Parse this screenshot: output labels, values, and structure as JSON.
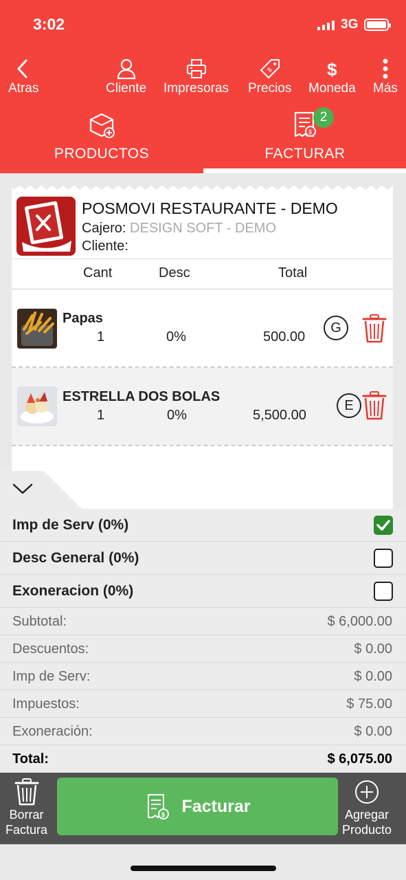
{
  "status_bar": {
    "time": "3:02",
    "network": "3G"
  },
  "toolbar": {
    "back_label": "Atras",
    "cliente_label": "Cliente",
    "impresoras_label": "Impresoras",
    "precios_label": "Precios",
    "moneda_symbol": "$",
    "moneda_label": "Moneda",
    "mas_label": "Más"
  },
  "tabs": {
    "productos_label": "PRODUCTOS",
    "facturar_label": "FACTURAR",
    "facturar_badge": "2",
    "active": "FACTURAR"
  },
  "receipt": {
    "restaurant_name": "POSMOVI RESTAURANTE - DEMO",
    "cajero_label": "Cajero:",
    "cajero_value": "DESIGN SOFT - DEMO",
    "cliente_label": "Cliente:",
    "columns": {
      "cant": "Cant",
      "desc": "Desc",
      "total": "Total"
    },
    "items": [
      {
        "name": "Papas",
        "qty": "1",
        "desc": "0%",
        "total": "500.00",
        "tag": "G"
      },
      {
        "name": "ESTRELLA DOS BOLAS",
        "qty": "1",
        "desc": "0%",
        "total": "5,500.00",
        "tag": "E"
      }
    ]
  },
  "options": [
    {
      "label": "Imp de Serv (0%)",
      "checked": true
    },
    {
      "label": "Desc General (0%)",
      "checked": false
    },
    {
      "label": "Exoneracion (0%)",
      "checked": false
    }
  ],
  "summary": {
    "subtotal_label": "Subtotal:",
    "subtotal_value": "$ 6,000.00",
    "descuentos_label": "Descuentos:",
    "descuentos_value": "$ 0.00",
    "impserv_label": "Imp de Serv:",
    "impserv_value": "$ 0.00",
    "impuestos_label": "Impuestos:",
    "impuestos_value": "$ 75.00",
    "exoneracion_label": "Exoneración:",
    "exoneracion_value": "$ 0.00",
    "total_label": "Total:",
    "total_value": "$ 6,075.00"
  },
  "bottom_bar": {
    "borrar_line1": "Borrar",
    "borrar_line2": "Factura",
    "facturar_label": "Facturar",
    "agregar_line1": "Agregar",
    "agregar_line2": "Producto"
  },
  "colors": {
    "brand_red": "#f4433c",
    "green": "#5cb85c",
    "check_green": "#2e8b2e",
    "bottom_bar": "#515151",
    "trash_red": "#e53935"
  }
}
